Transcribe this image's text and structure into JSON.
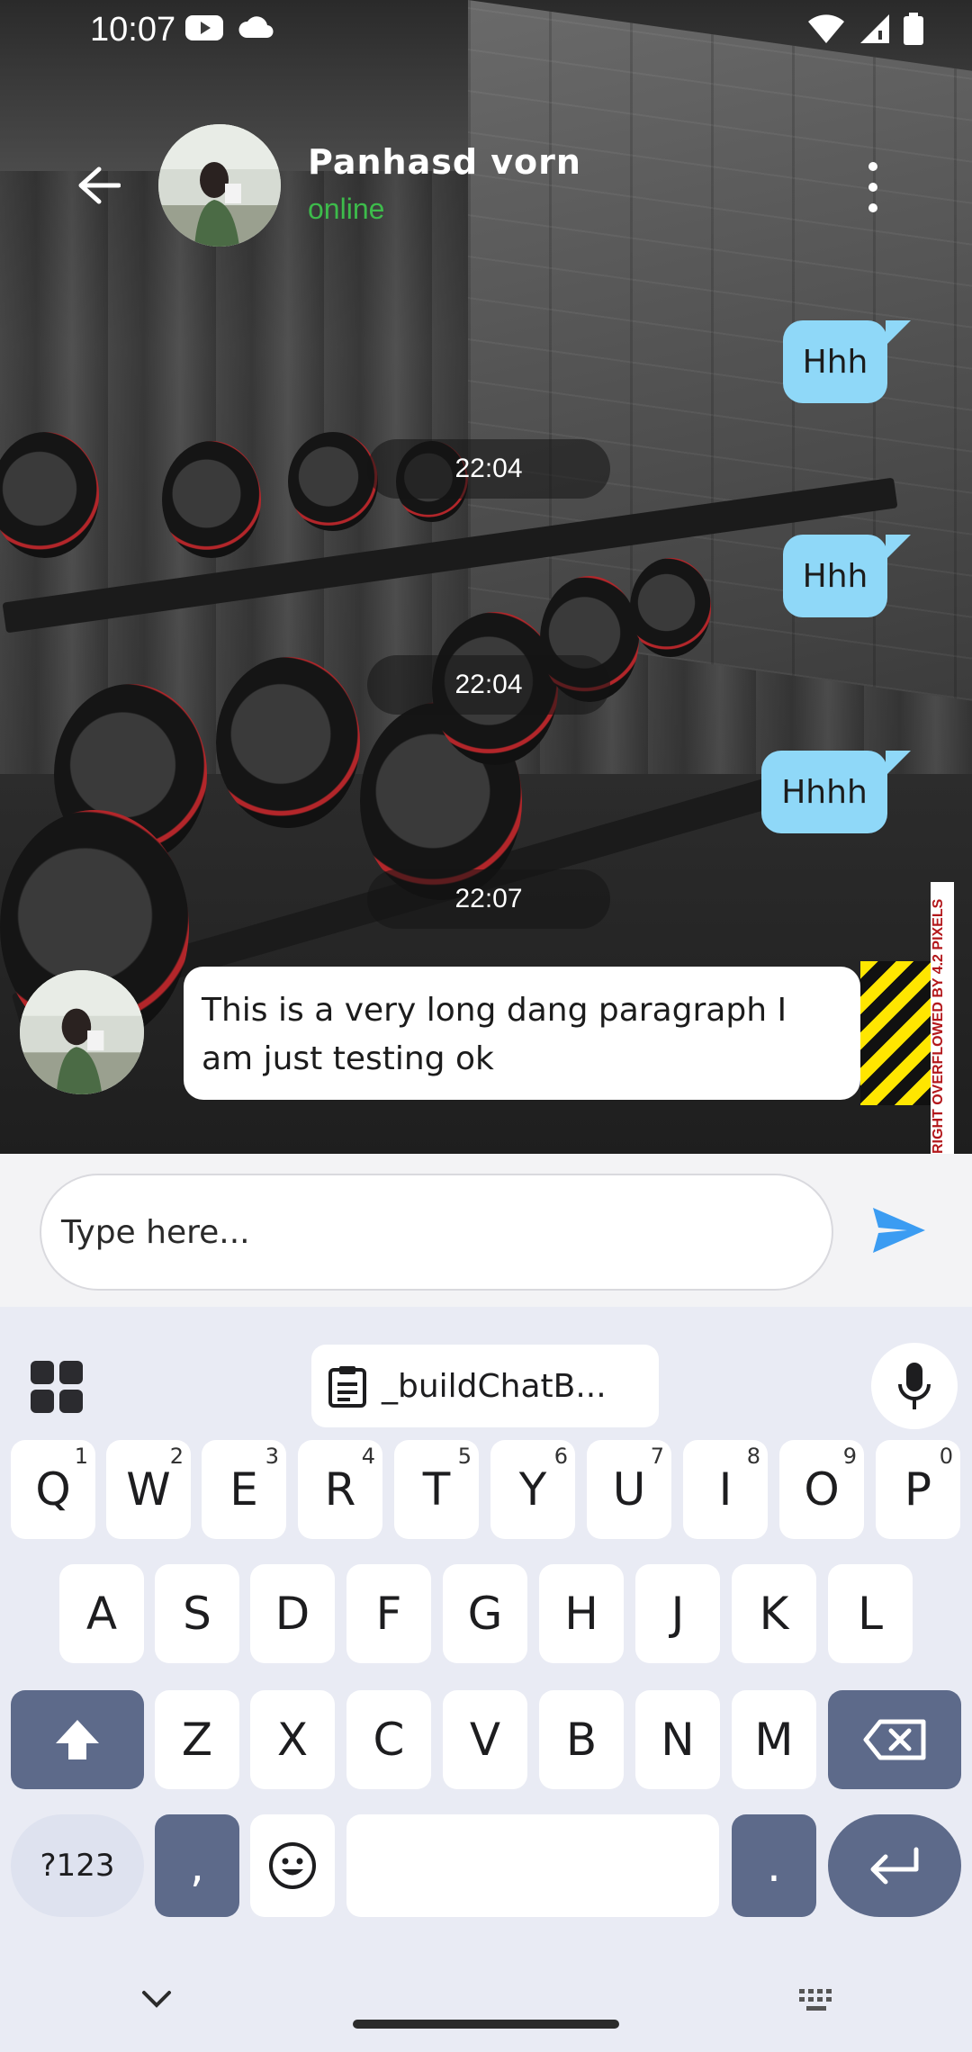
{
  "status_bar": {
    "time": "10:07",
    "icons_left": [
      "youtube-icon",
      "cloud-icon"
    ],
    "icons_right": [
      "wifi-icon",
      "signal-icon",
      "battery-icon"
    ]
  },
  "header": {
    "contact_name": "Panhasd vorn",
    "contact_status": "online",
    "status_color": "#3dbb4b"
  },
  "messages": [
    {
      "direction": "out",
      "text": "Hhh"
    },
    {
      "direction": "time",
      "text": "22:04"
    },
    {
      "direction": "out",
      "text": "Hhh"
    },
    {
      "direction": "time",
      "text": "22:04"
    },
    {
      "direction": "out",
      "text": "Hhhh"
    },
    {
      "direction": "time",
      "text": "22:07"
    },
    {
      "direction": "in",
      "text": "This is a very long dang paragraph I am just testing ok"
    }
  ],
  "overflow_warning": "RIGHT OVERFLOWED BY 4.2 PIXELS",
  "composer": {
    "placeholder": "Type here...",
    "send_color": "#3b9cf2"
  },
  "keyboard": {
    "clipboard_chip": "_buildChatB...",
    "row1": [
      {
        "key": "Q",
        "hint": "1"
      },
      {
        "key": "W",
        "hint": "2"
      },
      {
        "key": "E",
        "hint": "3"
      },
      {
        "key": "R",
        "hint": "4"
      },
      {
        "key": "T",
        "hint": "5"
      },
      {
        "key": "Y",
        "hint": "6"
      },
      {
        "key": "U",
        "hint": "7"
      },
      {
        "key": "I",
        "hint": "8"
      },
      {
        "key": "O",
        "hint": "9"
      },
      {
        "key": "P",
        "hint": "0"
      }
    ],
    "row2": [
      "A",
      "S",
      "D",
      "F",
      "G",
      "H",
      "J",
      "K",
      "L"
    ],
    "row3": [
      "Z",
      "X",
      "C",
      "V",
      "B",
      "N",
      "M"
    ],
    "symbols_label": "?123",
    "comma": ",",
    "period": "."
  },
  "colors": {
    "outgoing_bubble": "#8fd8f8",
    "incoming_bubble": "#ffffff",
    "keyboard_bg": "#e9ebf4",
    "action_key": "#5d6a8a"
  }
}
